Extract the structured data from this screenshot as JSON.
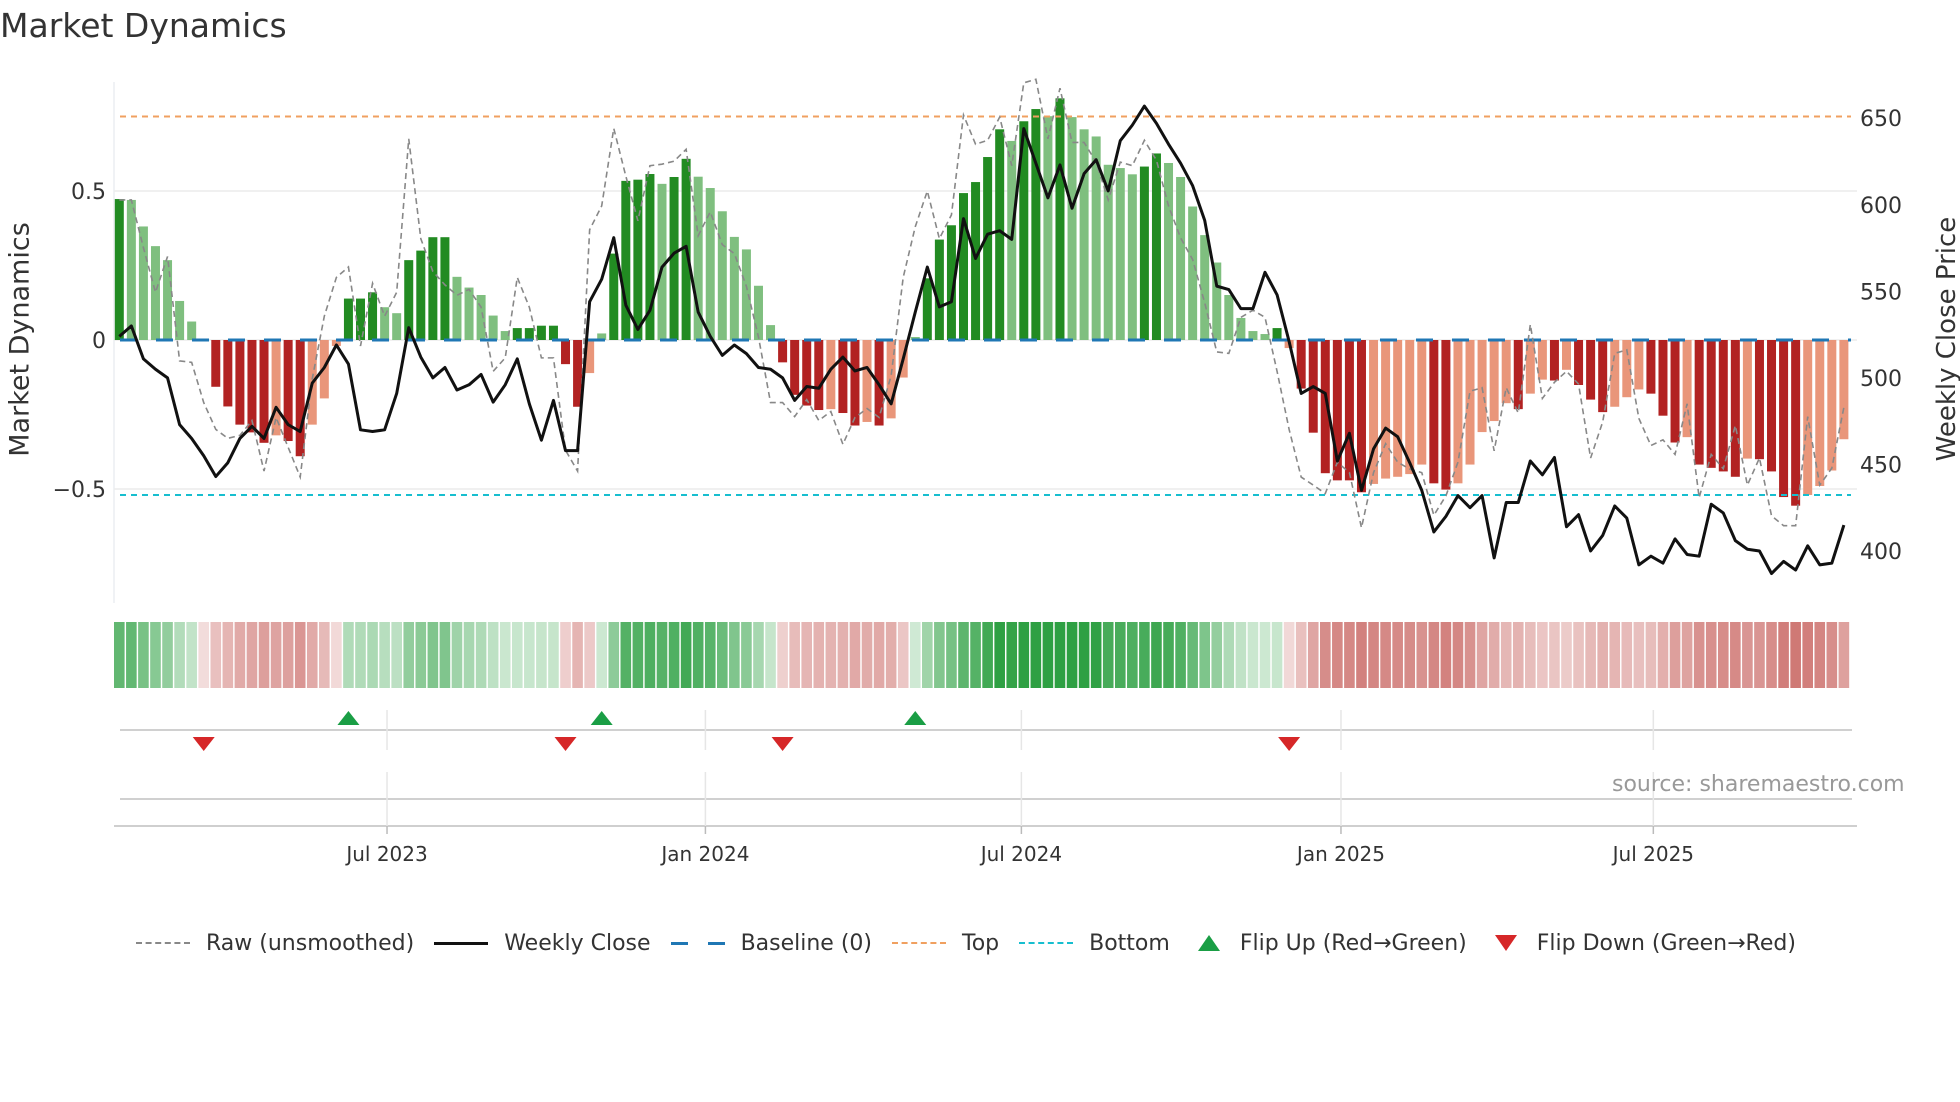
{
  "title": "Market Dynamics",
  "source": "source: sharemaestro.com",
  "legend": {
    "raw": "Raw (unsmoothed)",
    "close": "Weekly Close",
    "baseline": "Baseline (0)",
    "top": "Top",
    "bottom": "Bottom",
    "flip_up": "Flip Up (Red→Green)",
    "flip_down": "Flip Down (Green→Red)"
  },
  "colors": {
    "pos_strong": "#228b22",
    "pos_weak": "#7fbf7f",
    "neg_strong": "#b22222",
    "neg_weak": "#e9967a",
    "raw": "#888888",
    "close": "#111111",
    "baseline": "#1f77b4",
    "top": "#f0a060",
    "bottom": "#17becf",
    "flip_up": "#1a9e45",
    "flip_down": "#d62728"
  },
  "chart_data": {
    "type": "bar",
    "title": "Market Dynamics",
    "ylabel": "Market Dynamics",
    "y2label": "Weekly Close Price",
    "ylim": [
      -0.88,
      0.87
    ],
    "y2lim": [
      371,
      671
    ],
    "y_ticks": [
      {
        "value": 0.5,
        "label": "0.5"
      },
      {
        "value": 0,
        "label": "0"
      },
      {
        "value": -0.5,
        "label": "−0.5"
      }
    ],
    "y2_ticks": [
      {
        "value": 650,
        "label": "650"
      },
      {
        "value": 600,
        "label": "600"
      },
      {
        "value": 550,
        "label": "550"
      },
      {
        "value": 500,
        "label": "500"
      },
      {
        "value": 450,
        "label": "450"
      },
      {
        "value": 400,
        "label": "400"
      }
    ],
    "x_ticks": [
      {
        "week": 22.2,
        "label": "Jul 2023"
      },
      {
        "week": 48.6,
        "label": "Jan 2024"
      },
      {
        "week": 74.8,
        "label": "Jul 2024"
      },
      {
        "week": 101.3,
        "label": "Jan 2025"
      },
      {
        "week": 127.2,
        "label": "Jul 2025"
      }
    ],
    "baseline": 0,
    "top_threshold": 0.75,
    "bottom_threshold": -0.52,
    "dynamics": [
      0.473,
      0.47,
      0.381,
      0.315,
      0.268,
      0.131,
      0.062,
      -0.005,
      -0.157,
      -0.223,
      -0.284,
      -0.31,
      -0.345,
      -0.32,
      -0.339,
      -0.39,
      -0.284,
      -0.196,
      -0.02,
      0.139,
      0.139,
      0.16,
      0.11,
      0.09,
      0.268,
      0.3,
      0.345,
      0.345,
      0.212,
      0.176,
      0.151,
      0.082,
      0.03,
      0.04,
      0.04,
      0.048,
      0.048,
      -0.081,
      -0.224,
      -0.111,
      0.022,
      0.29,
      0.534,
      0.538,
      0.557,
      0.524,
      0.547,
      0.608,
      0.548,
      0.51,
      0.432,
      0.346,
      0.304,
      0.182,
      0.05,
      -0.075,
      -0.184,
      -0.22,
      -0.235,
      -0.232,
      -0.245,
      -0.287,
      -0.275,
      -0.287,
      -0.263,
      -0.126,
      0.01,
      0.207,
      0.337,
      0.385,
      0.493,
      0.53,
      0.614,
      0.707,
      0.668,
      0.734,
      0.775,
      0.751,
      0.811,
      0.748,
      0.707,
      0.683,
      0.588,
      0.577,
      0.556,
      0.582,
      0.626,
      0.594,
      0.547,
      0.448,
      0.352,
      0.26,
      0.151,
      0.074,
      0.03,
      0.02,
      0.04,
      -0.027,
      -0.163,
      -0.311,
      -0.447,
      -0.471,
      -0.471,
      -0.511,
      -0.483,
      -0.465,
      -0.459,
      -0.45,
      -0.418,
      -0.481,
      -0.502,
      -0.481,
      -0.418,
      -0.309,
      -0.272,
      -0.212,
      -0.232,
      -0.18,
      -0.133,
      -0.136,
      -0.1,
      -0.151,
      -0.2,
      -0.242,
      -0.224,
      -0.192,
      -0.166,
      -0.18,
      -0.254,
      -0.344,
      -0.326,
      -0.418,
      -0.429,
      -0.441,
      -0.459,
      -0.398,
      -0.4,
      -0.441,
      -0.527,
      -0.556,
      -0.52,
      -0.49,
      -0.438,
      -0.333
    ],
    "raw": [
      0.47,
      0.47,
      0.31,
      0.16,
      0.28,
      -0.07,
      -0.075,
      -0.21,
      -0.3,
      -0.33,
      -0.32,
      -0.27,
      -0.44,
      -0.26,
      -0.36,
      -0.46,
      -0.13,
      0.08,
      0.21,
      0.245,
      -0.02,
      0.19,
      0.08,
      0.16,
      0.675,
      0.34,
      0.23,
      0.185,
      0.15,
      0.17,
      0.11,
      -0.105,
      -0.06,
      0.21,
      0.11,
      -0.06,
      -0.06,
      -0.37,
      -0.44,
      0.37,
      0.45,
      0.71,
      0.55,
      0.4,
      0.585,
      0.59,
      0.6,
      0.64,
      0.35,
      0.43,
      0.32,
      0.29,
      0.18,
      0.01,
      -0.21,
      -0.21,
      -0.257,
      -0.2,
      -0.27,
      -0.24,
      -0.35,
      -0.26,
      -0.23,
      -0.26,
      -0.12,
      0.21,
      0.38,
      0.5,
      0.34,
      0.42,
      0.755,
      0.657,
      0.67,
      0.748,
      0.585,
      0.863,
      0.875,
      0.675,
      0.845,
      0.663,
      0.663,
      0.597,
      0.47,
      0.597,
      0.585,
      0.67,
      0.603,
      0.45,
      0.343,
      0.27,
      0.125,
      -0.04,
      -0.045,
      0.076,
      0.1,
      0.076,
      -0.105,
      -0.3,
      -0.46,
      -0.487,
      -0.515,
      -0.41,
      -0.445,
      -0.63,
      -0.445,
      -0.348,
      -0.41,
      -0.433,
      -0.445,
      -0.588,
      -0.523,
      -0.41,
      -0.172,
      -0.16,
      -0.372,
      -0.16,
      -0.245,
      0.052,
      -0.196,
      -0.142,
      -0.105,
      -0.148,
      -0.396,
      -0.275,
      -0.045,
      -0.033,
      -0.263,
      -0.354,
      -0.335,
      -0.384,
      -0.214,
      -0.529,
      -0.384,
      -0.432,
      -0.287,
      -0.487,
      -0.396,
      -0.59,
      -0.623,
      -0.623,
      -0.257,
      -0.487,
      -0.43,
      -0.226
    ],
    "weekly_close": [
      524,
      530,
      511,
      505,
      500,
      473,
      465,
      455,
      443,
      451,
      465,
      472,
      465,
      483,
      473,
      469,
      497,
      506,
      519,
      508,
      470,
      469,
      470,
      491,
      529,
      512,
      500,
      506,
      493,
      496,
      502,
      486,
      496,
      511,
      485,
      464,
      487,
      458,
      458,
      544,
      557,
      581,
      542,
      528,
      539,
      564,
      572,
      576,
      538,
      524,
      513,
      519,
      514,
      506,
      505,
      500,
      487,
      495,
      494,
      505,
      512,
      504,
      506,
      496,
      485,
      511,
      538,
      564,
      541,
      544,
      592,
      569,
      583,
      585,
      580,
      644,
      624,
      604,
      623,
      598,
      618,
      626,
      608,
      637,
      646,
      657,
      647,
      635,
      624,
      611,
      591,
      553,
      551,
      540,
      540,
      561,
      548,
      521,
      491,
      495,
      491,
      452,
      468,
      435,
      459,
      471,
      466,
      451,
      435,
      411,
      420,
      432,
      425,
      432,
      396,
      428,
      428,
      452,
      444,
      454,
      414,
      421,
      400,
      409,
      426,
      419,
      392,
      397,
      393,
      407,
      398,
      397,
      427,
      422,
      406,
      401,
      400,
      387,
      394,
      389,
      403,
      392,
      393,
      415
    ],
    "flips": [
      {
        "week": 7,
        "type": "down"
      },
      {
        "week": 19,
        "type": "up"
      },
      {
        "week": 37,
        "type": "down"
      },
      {
        "week": 40,
        "type": "up"
      },
      {
        "week": 55,
        "type": "down"
      },
      {
        "week": 66,
        "type": "up"
      },
      {
        "week": 97,
        "type": "down"
      }
    ]
  }
}
